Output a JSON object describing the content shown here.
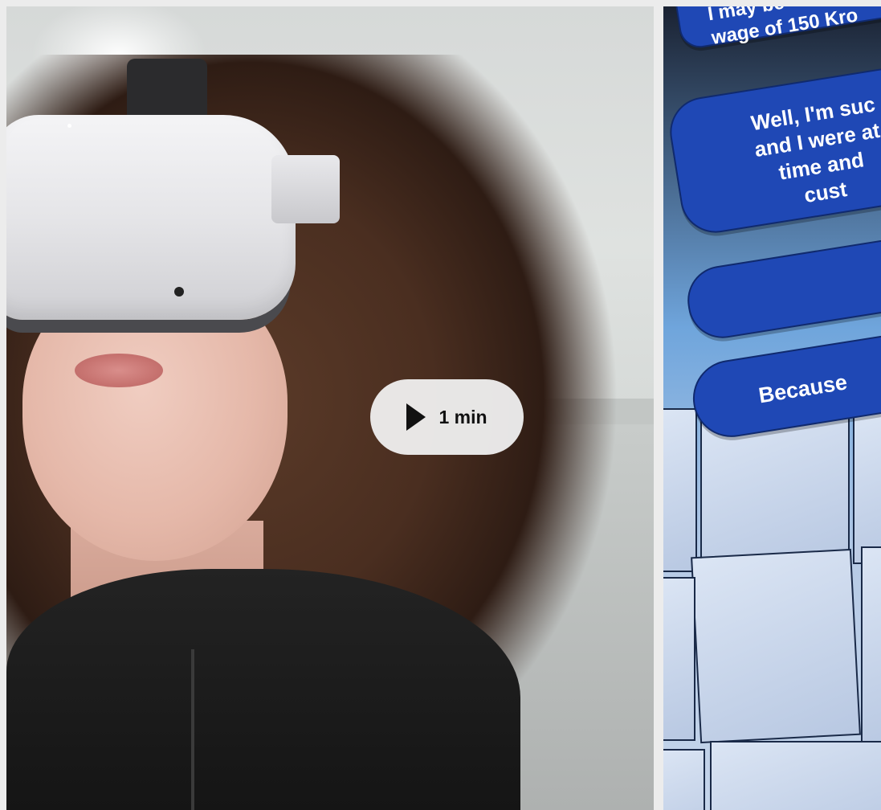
{
  "video": {
    "duration_label": "1 min",
    "play_icon": "play-icon"
  },
  "vr_dialog": {
    "options": [
      {
        "text": "I may be\nwage of 150 Kro"
      },
      {
        "text": "Well, I'm suc\nand I were at\ntime and\ncust"
      },
      {
        "text": ""
      },
      {
        "text": "Because"
      }
    ]
  },
  "colors": {
    "bubble": "#1f48b5",
    "badge": "#f0f0f0"
  }
}
